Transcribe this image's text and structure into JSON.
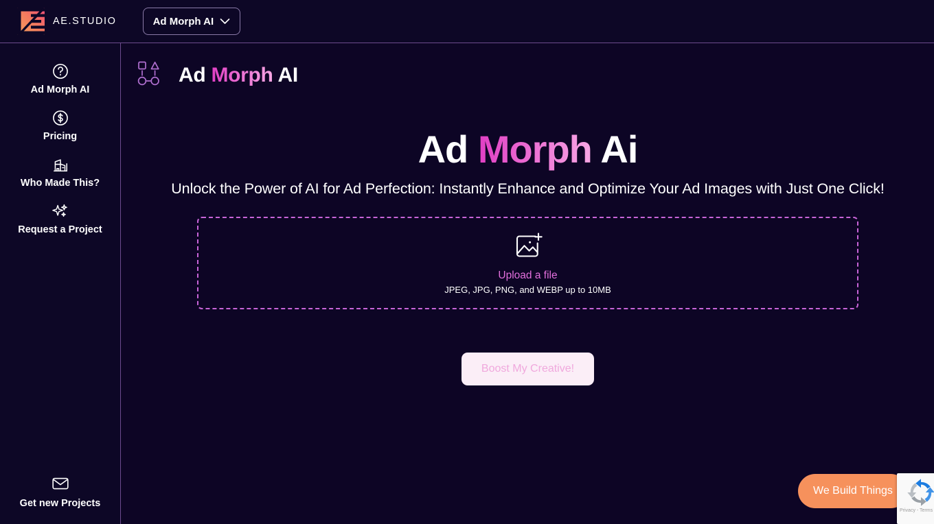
{
  "header": {
    "logo_icon": "ae-studio-logo-icon",
    "brand": "AE.STUDIO",
    "product_switcher": {
      "label": "Ad Morph AI",
      "chevron_icon": "chevron-down-icon"
    }
  },
  "sidebar": {
    "items": [
      {
        "label": "Ad Morph AI",
        "icon": "question-circle-icon"
      },
      {
        "label": "Pricing",
        "icon": "dollar-circle-icon"
      },
      {
        "label": "Who Made This?",
        "icon": "building-crane-icon"
      },
      {
        "label": "Request a Project",
        "icon": "sparkles-icon"
      }
    ],
    "bottom_item": {
      "label": "Get new Projects",
      "icon": "envelope-icon"
    }
  },
  "main": {
    "page_icon": "morph-shapes-icon",
    "page_title": {
      "part1": "Ad ",
      "part2": "Morph",
      "part3": " AI"
    },
    "hero": {
      "title": {
        "part1": "Ad ",
        "part2": "Morph",
        "part3": " Ai"
      },
      "subtitle": "Unlock the Power of AI for Ad Perfection: Instantly Enhance and Optimize Your Ad Images with Just One Click!"
    },
    "dropzone": {
      "icon": "image-plus-icon",
      "link_text": "Upload a file",
      "hint_text": "JPEG, JPG, PNG, and WEBP up to 10MB"
    },
    "cta": {
      "label": "Boost My Creative!"
    }
  },
  "widgets": {
    "we_build_things": {
      "label": "We Build Things"
    },
    "recaptcha": {
      "icon": "recaptcha-icon",
      "legal": "Privacy - Terms"
    }
  },
  "colors": {
    "page_bg": "#0d0525",
    "panel_bg": "#0d0726",
    "divider": "#6d4b8e",
    "accent_pink": "#e26fdc",
    "accent_magenta": "#e13ec4",
    "accent_pink_light": "#f7a7e4",
    "cta_bg": "#fbeef7",
    "cta_text": "#f0a8dd",
    "orange_pill": "#f6915c",
    "dropzone_border": "#c864d8"
  }
}
